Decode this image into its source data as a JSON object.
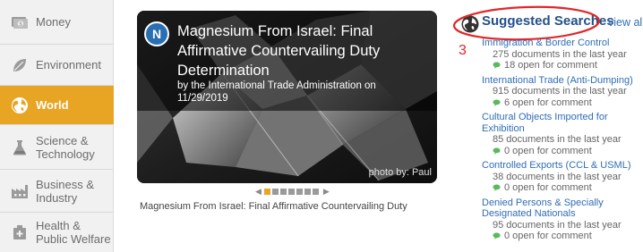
{
  "sidebar": {
    "items": [
      {
        "label": "Money",
        "icon": "money-icon",
        "active": false
      },
      {
        "label": "Environment",
        "icon": "leaf-icon",
        "active": false
      },
      {
        "label": "World",
        "icon": "globe-icon",
        "active": true
      },
      {
        "label": "Science &\nTechnology",
        "icon": "flask-icon",
        "active": false
      },
      {
        "label": "Business &\nIndustry",
        "icon": "factory-icon",
        "active": false
      },
      {
        "label": "Health &\nPublic Welfare",
        "icon": "medical-kit-icon",
        "active": false
      }
    ]
  },
  "featured": {
    "badge": "N",
    "title": "Magnesium From Israel: Final Affirmative Countervailing Duty Determination",
    "byline": "by the International Trade Administration on 11/29/2019",
    "photo_credit": "photo by: Paul",
    "caption": "Magnesium From Israel: Final Affirmative Countervailing Duty",
    "pager": {
      "prev": "◀",
      "next": "▶",
      "dots": 7,
      "active_index": 0
    }
  },
  "suggested": {
    "title": "Suggested Searches",
    "view_all": "view all",
    "annotation_number": "3",
    "items": [
      {
        "title": "Immigration & Border Control",
        "docs": "275 documents in the last year",
        "open": "18 open for comment"
      },
      {
        "title": "International Trade (Anti-Dumping)",
        "docs": "915 documents in the last year",
        "open": "6 open for comment"
      },
      {
        "title": "Cultural Objects Imported for Exhibition",
        "docs": "85 documents in the last year",
        "open": "0 open for comment"
      },
      {
        "title": "Controlled Exports (CCL & USML)",
        "docs": "38 documents in the last year",
        "open": "0 open for comment"
      },
      {
        "title": "Denied Persons & Specially Designated Nationals",
        "docs": "95 documents in the last year",
        "open": "0 open for comment"
      }
    ]
  },
  "colors": {
    "accent": "#e8a423",
    "link": "#2f6db5",
    "annotation": "#e0282a",
    "comment": "#5cb85c"
  }
}
